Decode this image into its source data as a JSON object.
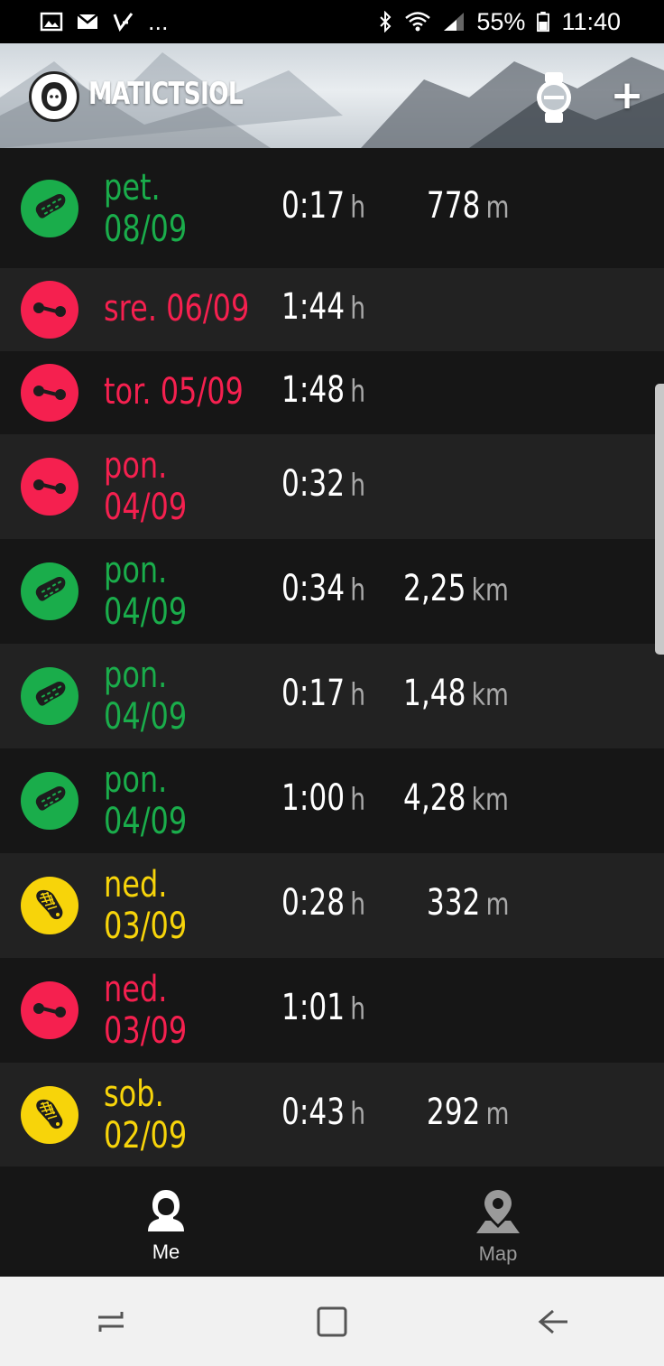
{
  "status_bar": {
    "left_icons": [
      "image-icon",
      "gmail-icon",
      "check-icon"
    ],
    "overflow": "...",
    "battery_percent": "55%",
    "time": "11:40",
    "right_icons": [
      "bluetooth-icon",
      "wifi-icon",
      "signal-icon",
      "battery-icon"
    ]
  },
  "header": {
    "username": "MATICTSIOL",
    "avatar_icon": "avatar-icon",
    "watch_icon": "watch-icon",
    "add_label": "+"
  },
  "colors": {
    "green": "#1aad4b",
    "red": "#f5204f",
    "yellow": "#f7d40a"
  },
  "activities": [
    {
      "type": "hiking",
      "color": "green",
      "date": "pet.\n08/09",
      "duration": "0:17",
      "duration_unit": "h",
      "distance": "778",
      "distance_unit": "m"
    },
    {
      "type": "gym",
      "color": "red",
      "date": "sre. 06/09",
      "duration": "1:44",
      "duration_unit": "h",
      "distance": "",
      "distance_unit": ""
    },
    {
      "type": "gym",
      "color": "red",
      "date": "tor. 05/09",
      "duration": "1:48",
      "duration_unit": "h",
      "distance": "",
      "distance_unit": ""
    },
    {
      "type": "gym",
      "color": "red",
      "date": "pon.\n04/09",
      "duration": "0:32",
      "duration_unit": "h",
      "distance": "",
      "distance_unit": ""
    },
    {
      "type": "hiking",
      "color": "green",
      "date": "pon.\n04/09",
      "duration": "0:34",
      "duration_unit": "h",
      "distance": "2,25",
      "distance_unit": "km"
    },
    {
      "type": "hiking",
      "color": "green",
      "date": "pon.\n04/09",
      "duration": "0:17",
      "duration_unit": "h",
      "distance": "1,48",
      "distance_unit": "km"
    },
    {
      "type": "hiking",
      "color": "green",
      "date": "pon.\n04/09",
      "duration": "1:00",
      "duration_unit": "h",
      "distance": "4,28",
      "distance_unit": "km"
    },
    {
      "type": "running",
      "color": "yellow",
      "date": "ned.\n03/09",
      "duration": "0:28",
      "duration_unit": "h",
      "distance": "332",
      "distance_unit": "m"
    },
    {
      "type": "gym",
      "color": "red",
      "date": "ned.\n03/09",
      "duration": "1:01",
      "duration_unit": "h",
      "distance": "",
      "distance_unit": ""
    },
    {
      "type": "running",
      "color": "yellow",
      "date": "sob.\n02/09",
      "duration": "0:43",
      "duration_unit": "h",
      "distance": "292",
      "distance_unit": "m"
    }
  ],
  "tabs": [
    {
      "label": "Me",
      "icon": "person-icon",
      "active": true
    },
    {
      "label": "Map",
      "icon": "map-pin-icon",
      "active": false
    }
  ],
  "nav": [
    "recents-icon",
    "home-icon",
    "back-icon"
  ]
}
